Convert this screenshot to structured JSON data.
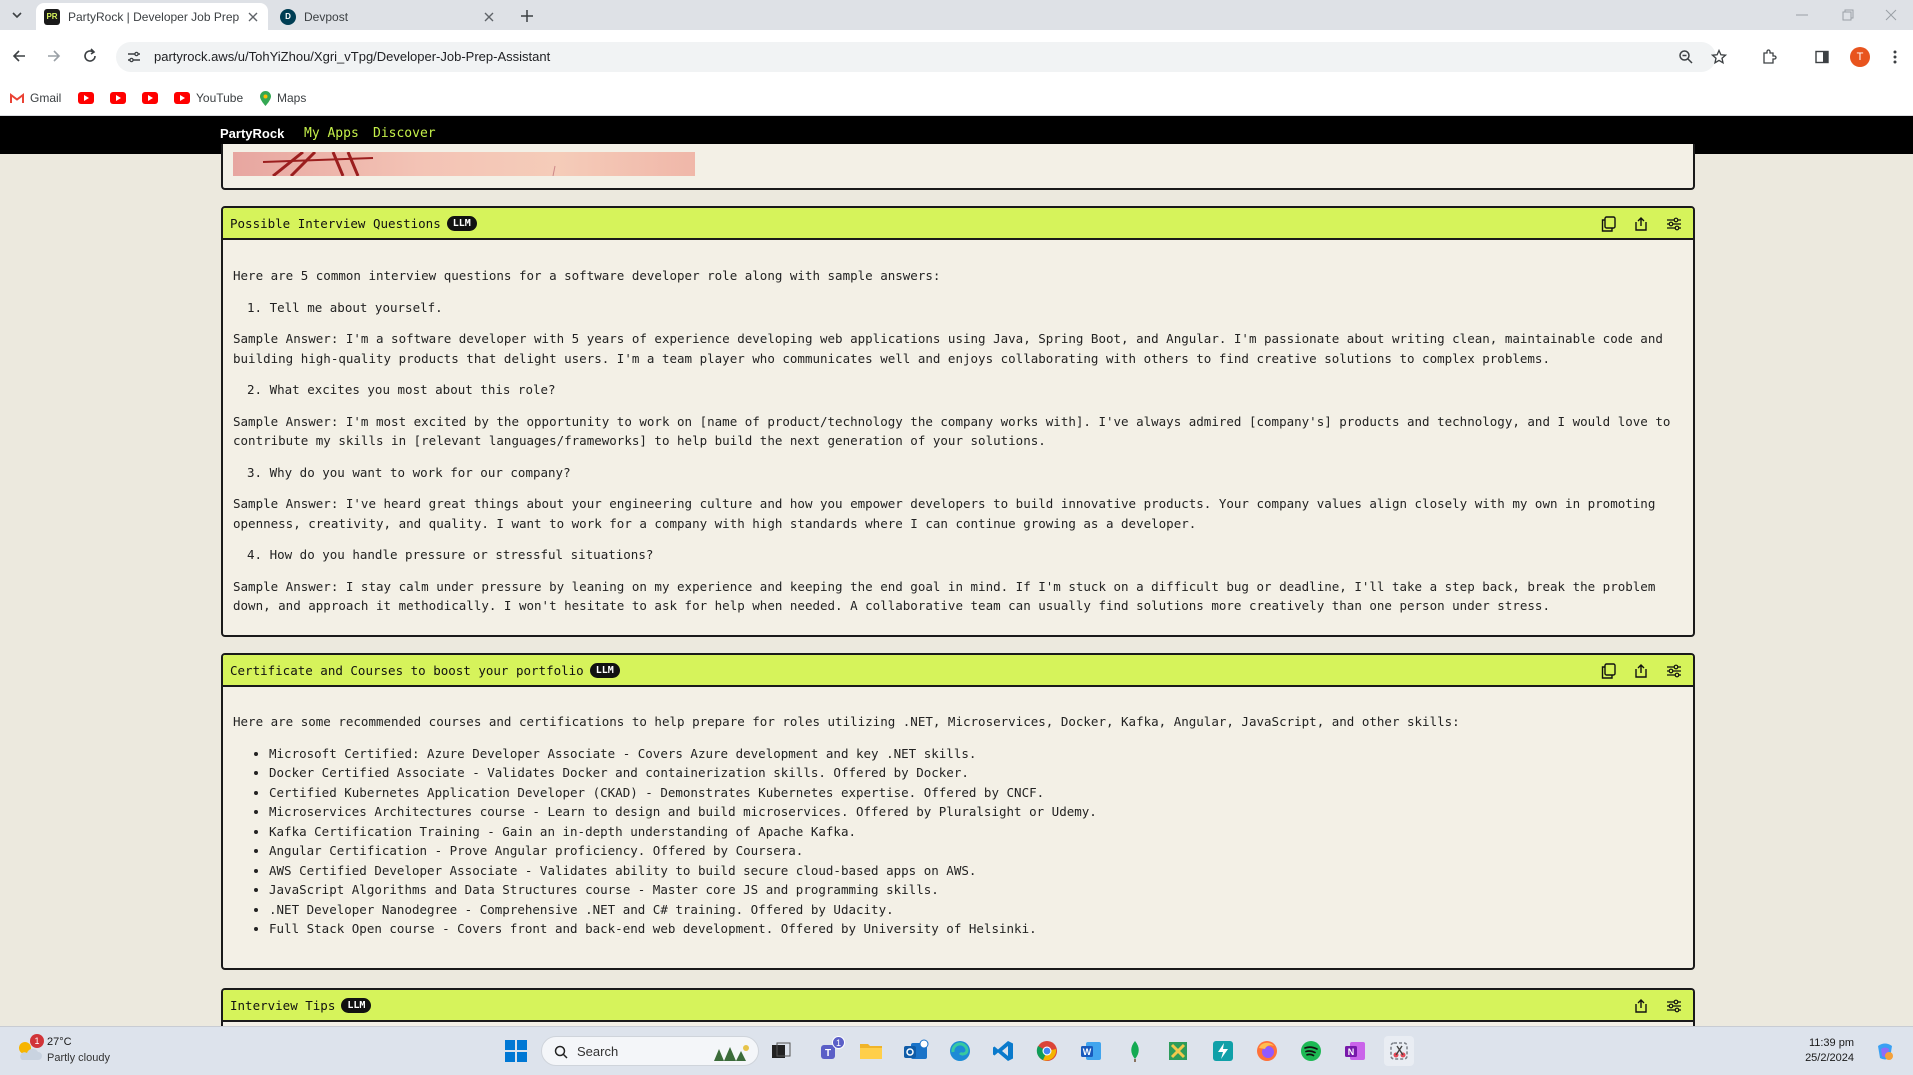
{
  "browser": {
    "tabs": [
      {
        "title": "PartyRock | Developer Job Prep",
        "favicon": "PR"
      },
      {
        "title": "Devpost",
        "favicon": "D"
      }
    ],
    "url": "partyrock.aws/u/TohYiZhou/Xgri_vTpg/Developer-Job-Prep-Assistant",
    "profile_initial": "T",
    "bookmarks": [
      {
        "label": "Gmail",
        "icon": "gmail-icon"
      },
      {
        "label": "",
        "icon": "youtube-icon"
      },
      {
        "label": "",
        "icon": "youtube-icon"
      },
      {
        "label": "",
        "icon": "youtube-icon"
      },
      {
        "label": "YouTube",
        "icon": "youtube-icon"
      },
      {
        "label": "Maps",
        "icon": "maps-icon"
      }
    ]
  },
  "partyrock_nav": {
    "brand": "PartyRock",
    "links": [
      "My Apps",
      "Discover"
    ]
  },
  "interview_card": {
    "title": "Possible Interview Questions",
    "badge": "LLM",
    "intro": "Here are 5 common interview questions for a software developer role along with sample answers:",
    "items": [
      {
        "question": "1. Tell me about yourself.",
        "answer": "Sample Answer: I'm a software developer with 5 years of experience developing web applications using Java, Spring Boot, and Angular. I'm passionate about writing clean, maintainable code and building high-quality products that delight users. I'm a team player who communicates well and enjoys collaborating with others to find creative solutions to complex problems."
      },
      {
        "question": "2. What excites you most about this role?",
        "answer": "Sample Answer: I'm most excited by the opportunity to work on [name of product/technology the company works with]. I've always admired [company's] products and technology, and I would love to contribute my skills in [relevant languages/frameworks] to help build the next generation of your solutions."
      },
      {
        "question": "3. Why do you want to work for our company?",
        "answer": "Sample Answer: I've heard great things about your engineering culture and how you empower developers to build innovative products. Your company values align closely with my own in promoting openness, creativity, and quality. I want to work for a company with high standards where I can continue growing as a developer."
      },
      {
        "question": "4. How do you handle pressure or stressful situations?",
        "answer": "Sample Answer: I stay calm under pressure by leaning on my experience and keeping the end goal in mind. If I'm stuck on a difficult bug or deadline, I'll take a step back, break the problem down, and approach it methodically. I won't hesitate to ask for help when needed. A collaborative team can usually find solutions more creatively than one person under stress."
      }
    ]
  },
  "courses_card": {
    "title": "Certificate and Courses to boost your portfolio",
    "badge": "LLM",
    "intro": "Here are some recommended courses and certifications to help prepare for roles utilizing .NET, Microservices, Docker, Kafka, Angular, JavaScript, and other skills:",
    "items": [
      "Microsoft Certified: Azure Developer Associate - Covers Azure development and key .NET skills.",
      "Docker Certified Associate - Validates Docker and containerization skills. Offered by Docker.",
      "Certified Kubernetes Application Developer (CKAD) - Demonstrates Kubernetes expertise. Offered by CNCF.",
      "Microservices Architectures course - Learn to design and build microservices. Offered by Pluralsight or Udemy.",
      "Kafka Certification Training - Gain an in-depth understanding of Apache Kafka.",
      "Angular Certification - Prove Angular proficiency. Offered by Coursera.",
      "AWS Certified Developer Associate - Validates ability to build secure cloud-based apps on AWS.",
      "JavaScript Algorithms and Data Structures course - Master core JS and programming skills.",
      ".NET Developer Nanodegree - Comprehensive .NET and C# training. Offered by Udacity.",
      "Full Stack Open course - Covers front and back-end web development. Offered by University of Helsinki."
    ]
  },
  "tips_card": {
    "title": "Interview Tips",
    "badge": "LLM"
  },
  "taskbar": {
    "weather_temp": "27°C",
    "weather_desc": "Partly cloudy",
    "weather_badge": "1",
    "search_placeholder": "Search",
    "teams_badge": "1",
    "time": "11:39 pm",
    "date": "25/2/2024"
  },
  "colors": {
    "card_header": "#d6f35b",
    "page_bg": "#ece9de",
    "nav_link": "#c5f04a"
  }
}
